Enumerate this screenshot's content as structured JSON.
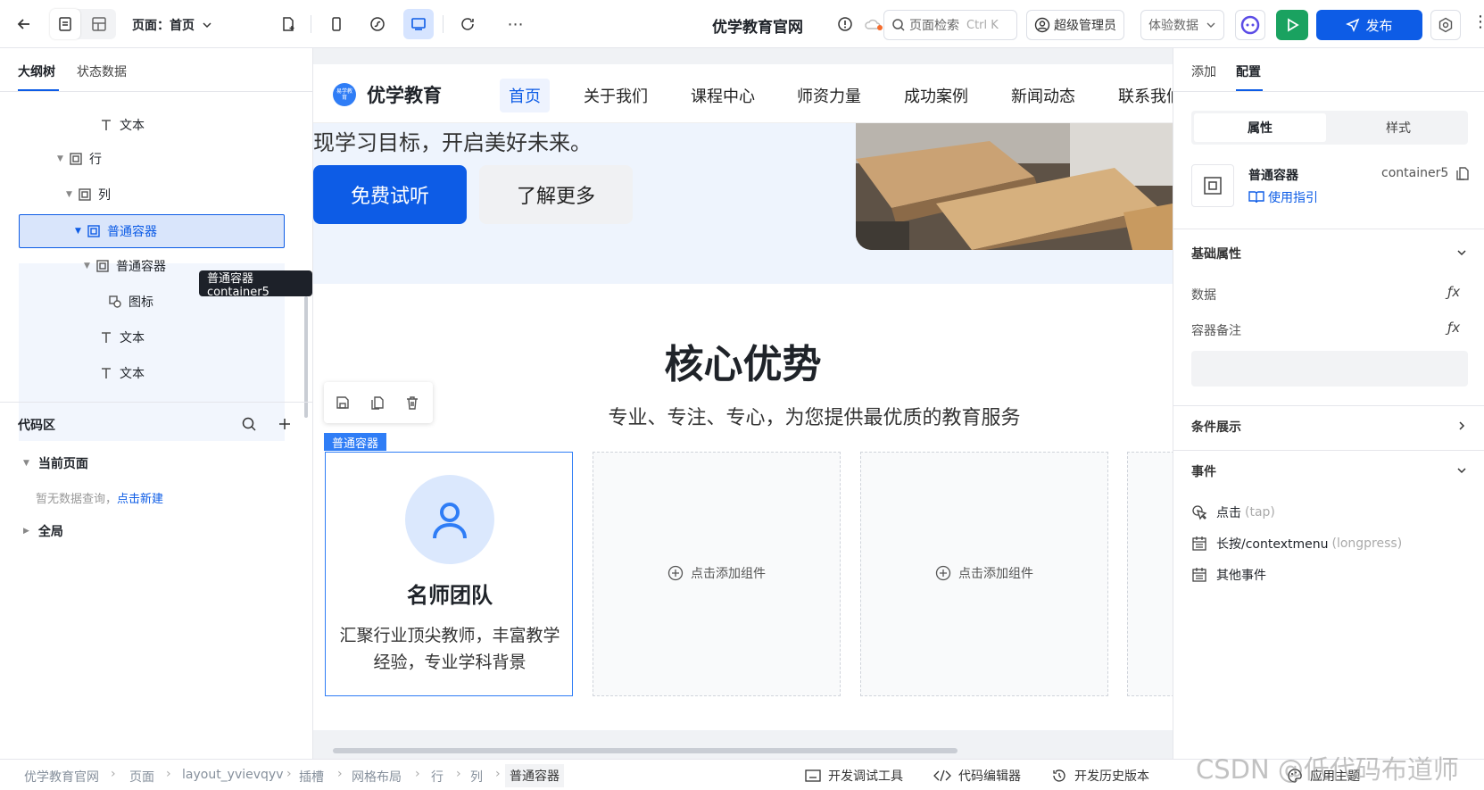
{
  "topbar": {
    "page_label": "页面：首页",
    "site_title": "优学教育官网",
    "search_placeholder": "页面检索",
    "search_shortcut": "Ctrl K",
    "user_label": "超级管理员",
    "data_select": "体验数据",
    "publish_label": "发布"
  },
  "left": {
    "tabs": [
      "大纲树",
      "状态数据"
    ],
    "tree": [
      {
        "label": "文本",
        "icon": "text-icon"
      },
      {
        "label": "行",
        "icon": "container-icon"
      },
      {
        "label": "列",
        "icon": "container-icon"
      },
      {
        "label": "普通容器",
        "icon": "container-icon"
      },
      {
        "label": "普通容器",
        "icon": "container-icon"
      },
      {
        "label": "图标",
        "icon": "shapes-icon"
      },
      {
        "label": "文本",
        "icon": "text-icon"
      },
      {
        "label": "文本",
        "icon": "text-icon"
      }
    ],
    "tooltip": "普通容器 container5",
    "code_title": "代码区",
    "current_page": "当前页面",
    "empty_text": "暂无数据查询，",
    "create_link": "点击新建",
    "global": "全局"
  },
  "site": {
    "brand": "优学教育",
    "logo_text": "易学教育",
    "nav": [
      "首页",
      "关于我们",
      "课程中心",
      "师资力量",
      "成功案例",
      "新闻动态",
      "联系我们"
    ],
    "hero_text": "现学习目标，开启美好未来。",
    "btn_primary": "免费试听",
    "btn_secondary": "了解更多",
    "section_title": "核心优势",
    "section_subtitle": "专业、专注、专心，为您提供最优质的教育服务",
    "selected_tag": "普通容器",
    "card_title": "名师团队",
    "card_desc": "汇聚行业顶尖教师，丰富教学经验，专业学科背景",
    "add_component": "点击添加组件"
  },
  "right": {
    "tabs": [
      "添加",
      "配置"
    ],
    "subtabs": [
      "属性",
      "样式"
    ],
    "comp_name": "普通容器",
    "comp_id": "container5",
    "guide": "使用指引",
    "basic_props": "基础属性",
    "data_label": "数据",
    "note_label": "容器备注",
    "fx": "ƒx",
    "conditional": "条件展示",
    "events": "事件",
    "event_tap": "点击",
    "event_tap_en": "(tap)",
    "event_long": "长按/contextmenu",
    "event_long_en": "(longpress)",
    "event_other": "其他事件"
  },
  "bottom": {
    "breadcrumb": [
      "优学教育官网",
      "页面",
      "layout_yvievqyv",
      "插槽",
      "网格布局",
      "行",
      "列",
      "普通容器"
    ],
    "debug_tools": "开发调试工具",
    "code_editor": "代码编辑器",
    "history": "开发历史版本",
    "apply_theme": "应用主题",
    "watermark": "CSDN @低代码布道师"
  },
  "colors": {
    "accent": "#0d5ce6",
    "green": "#1aa260",
    "selected_bg": "#e8efff"
  }
}
